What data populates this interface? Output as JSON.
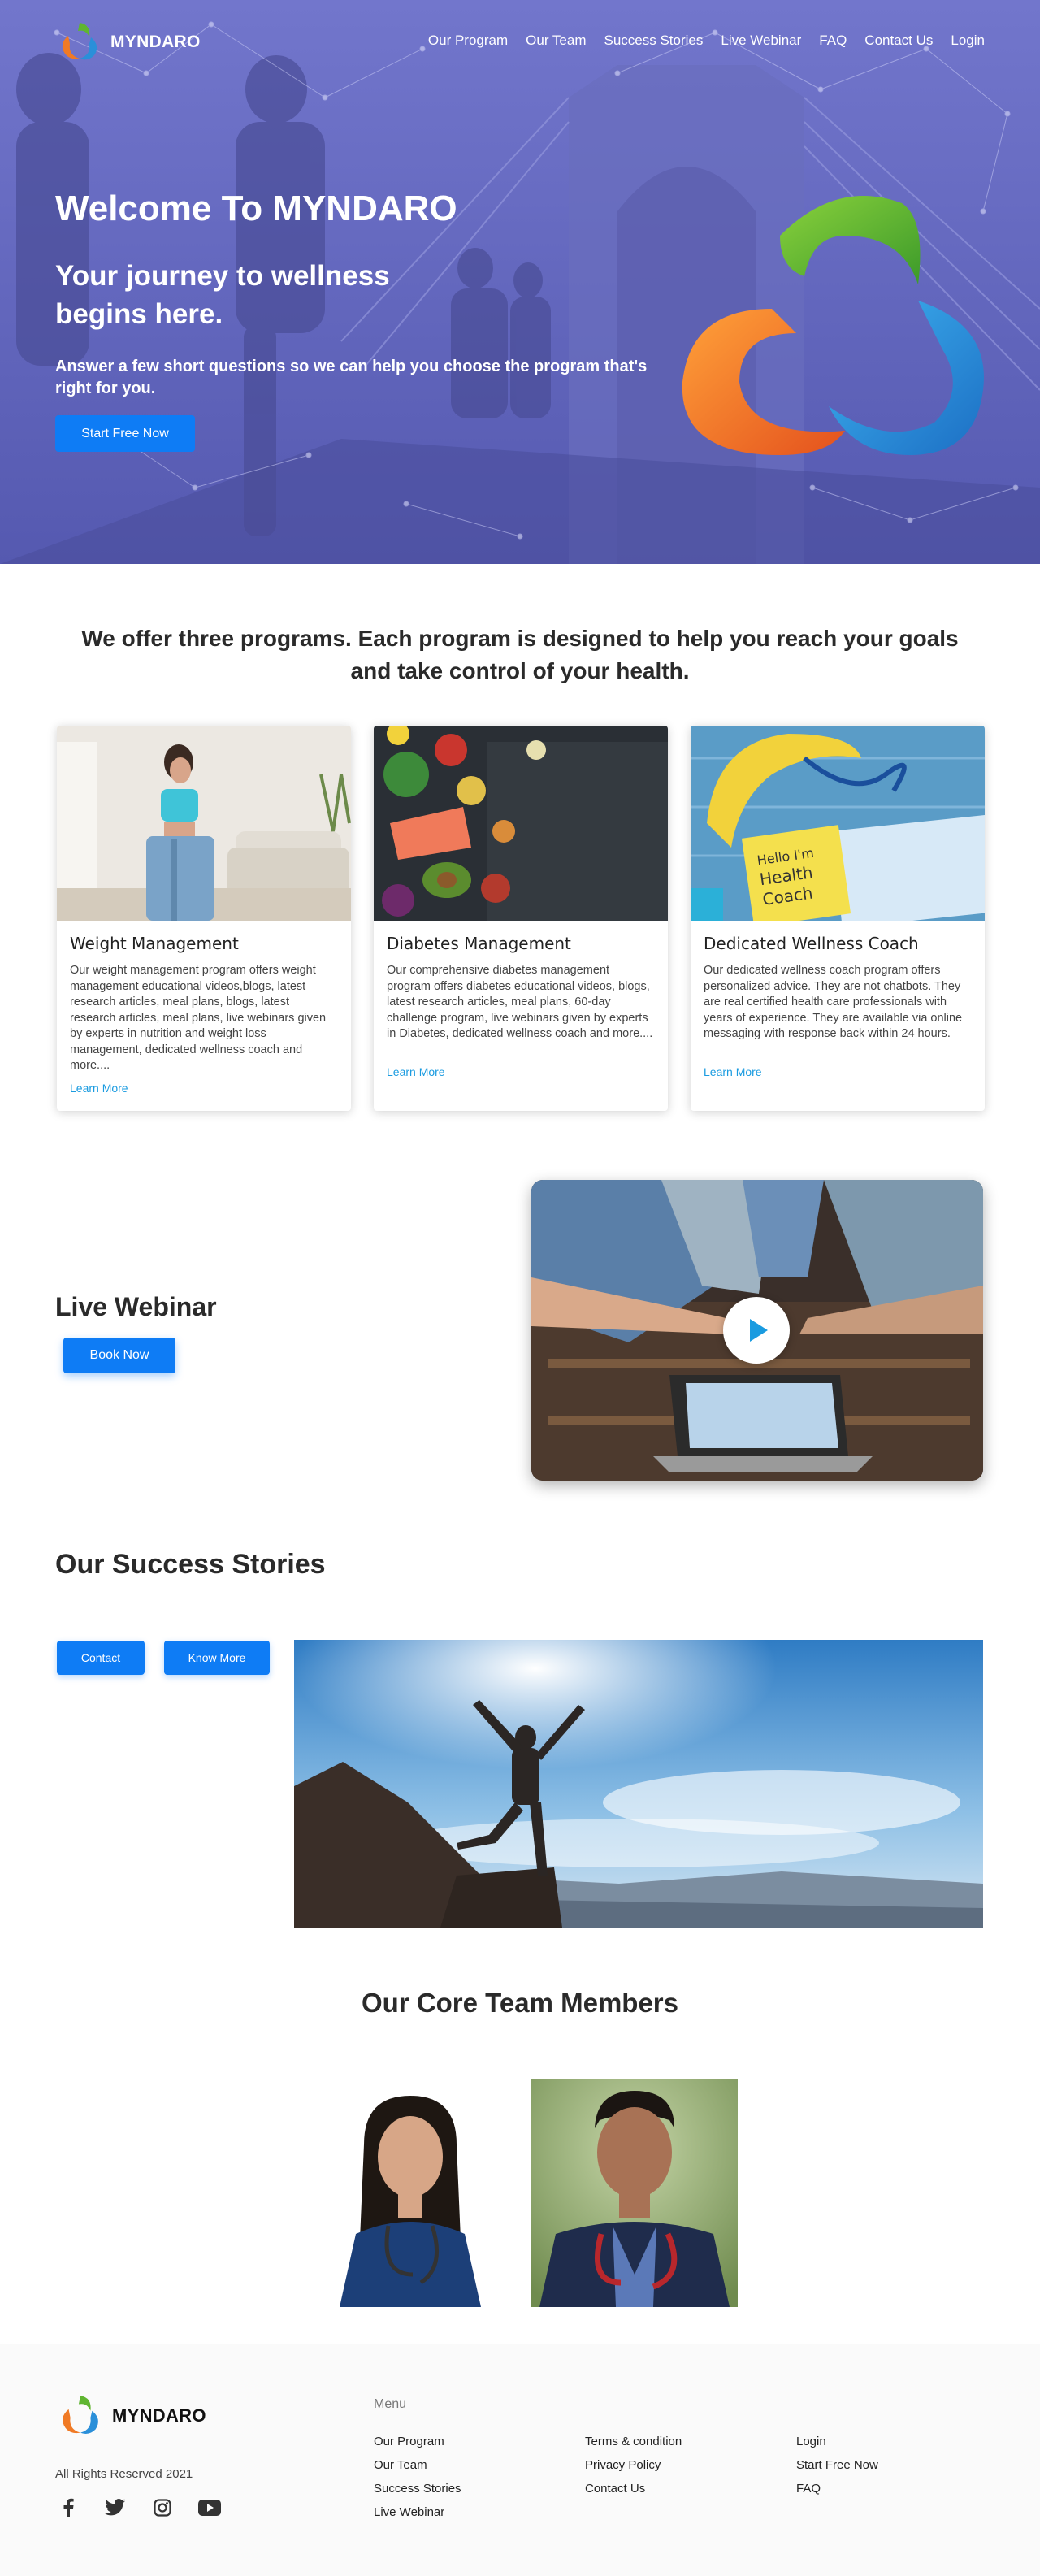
{
  "brand": {
    "name": "MYNDARO"
  },
  "nav": {
    "links": [
      "Our Program",
      "Our Team",
      "Success Stories",
      "Live Webinar",
      "FAQ",
      "Contact Us",
      "Login"
    ]
  },
  "hero": {
    "title": "Welcome To MYNDARO",
    "subtitle": "Your journey to wellness begins here.",
    "description": "Answer a few short questions so we can help you choose the program that's right for you.",
    "cta": "Start Free Now"
  },
  "programs": {
    "heading": "We offer three programs. Each program is designed to help you reach your goals and take control of your health.",
    "cards": [
      {
        "title": "Weight Management",
        "description": "Our weight management program offers weight management educational videos,blogs, latest research articles, meal plans, blogs, latest research articles, meal plans, live webinars given by experts in nutrition and weight loss management, dedicated wellness coach and more....",
        "link": "Learn More"
      },
      {
        "title": "Diabetes Management",
        "description": "Our comprehensive diabetes management program offers diabetes educational videos, blogs, latest research articles, meal plans, 60-day challenge program, live webinars given by experts in Diabetes, dedicated wellness coach and more....",
        "link": "Learn More"
      },
      {
        "title": "Dedicated Wellness Coach",
        "description": "Our dedicated wellness coach program offers personalized advice. They are not chatbots. They are real certified health care professionals with years of experience. They are available via online messaging with response back within 24 hours.",
        "link": "Learn More"
      }
    ]
  },
  "webinar": {
    "title": "Live Webinar",
    "button": "Book Now"
  },
  "success": {
    "title": "Our Success Stories",
    "contact_button": "Contact",
    "more_button": "Know More"
  },
  "team": {
    "title": "Our Core Team Members"
  },
  "footer": {
    "rights": "All Rights Reserved 2021",
    "menu_title": "Menu",
    "col1": [
      "Our Program",
      "Our Team",
      "Success Stories",
      "Live Webinar"
    ],
    "col2": [
      "Terms & condition",
      "Privacy Policy",
      "Contact Us"
    ],
    "col3": [
      "Login",
      "Start Free Now",
      "FAQ"
    ]
  },
  "colors": {
    "primary": "#0e7cf5",
    "hero_overlay": "#6266c0",
    "link": "#1a9be0"
  },
  "icons": [
    "facebook-icon",
    "twitter-icon",
    "instagram-icon",
    "youtube-icon",
    "play-icon"
  ]
}
